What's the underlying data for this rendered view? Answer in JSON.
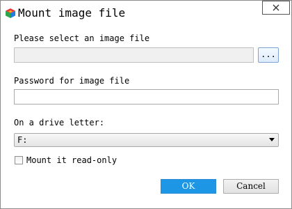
{
  "window": {
    "title": "Mount image file",
    "app_icon": "colorful-cube-icon",
    "close_icon": "close-icon"
  },
  "image_file": {
    "label": "Please select an image file",
    "value": "",
    "browse_label": "..."
  },
  "password": {
    "label": "Password for image file",
    "value": ""
  },
  "drive": {
    "label": "On a drive letter:",
    "selected": "F:"
  },
  "read_only": {
    "label": "Mount it read-only",
    "checked": false
  },
  "buttons": {
    "ok_label": "OK",
    "cancel_label": "Cancel"
  },
  "colors": {
    "primary_button": "#1e96e6",
    "border": "#a9a9a9"
  }
}
